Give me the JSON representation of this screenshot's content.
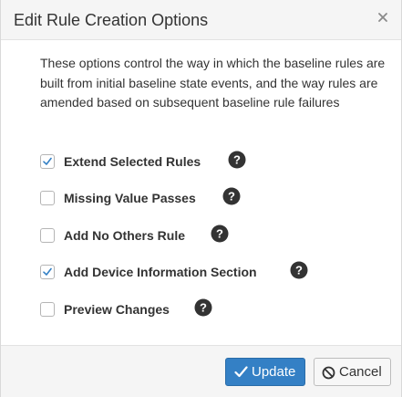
{
  "dialog": {
    "title": "Edit Rule Creation Options",
    "description": "These options control the way in which the baseline rules are built from initial baseline state events, and the way rules are amended based on subsequent baseline rule failures"
  },
  "options": [
    {
      "label": "Extend Selected Rules",
      "checked": true
    },
    {
      "label": "Missing Value Passes",
      "checked": false
    },
    {
      "label": "Add No Others Rule",
      "checked": false
    },
    {
      "label": "Add Device Information Section",
      "checked": true
    },
    {
      "label": "Preview Changes",
      "checked": false
    }
  ],
  "buttons": {
    "update_label": "Update",
    "cancel_label": "Cancel"
  },
  "icons": {
    "close": "close-icon",
    "help": "question-circle-icon",
    "check": "checkmark-icon",
    "ban": "ban-icon"
  },
  "colors": {
    "primary": "#3480c5",
    "check": "#3480c5",
    "help_icon": "#333333"
  }
}
